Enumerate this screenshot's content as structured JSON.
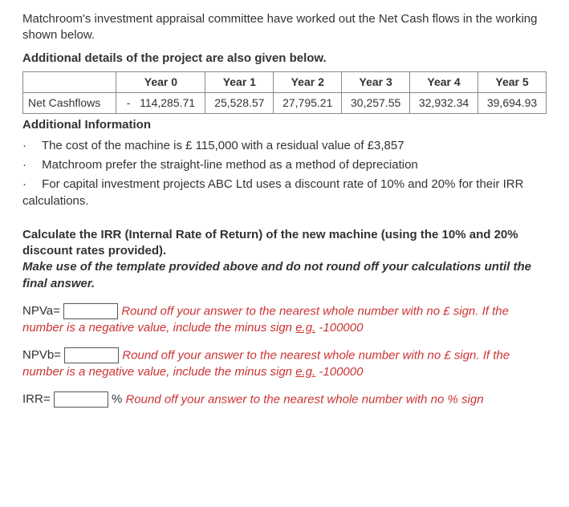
{
  "intro": "Matchroom's investment appraisal committee have worked out the Net Cash flows in the working shown below.",
  "section_title": "Additional details of the project are also given below.",
  "table": {
    "headers": [
      "",
      "Year 0",
      "Year 1",
      "Year 2",
      "Year 3",
      "Year 4",
      "Year 5"
    ],
    "row_label": "Net Cashflows",
    "values": [
      "-   114,285.71",
      "25,528.57",
      "27,795.21",
      "30,257.55",
      "32,932.34",
      "39,694.93"
    ]
  },
  "addl_title": "Additional Information",
  "bullets": [
    "The cost of the machine is £ 115,000 with a residual value of £3,857",
    "Matchroom prefer the straight-line method as a method of depreciation",
    "For capital investment projects ABC Ltd uses a discount rate of 10% and 20% for their IRR calculations."
  ],
  "calc": {
    "instruction": "Calculate the IRR (Internal Rate of Return) of the new machine (using the 10% and 20% discount rates provided).",
    "note": "Make use of the template provided above and do not round off your calculations until the final answer."
  },
  "answers": {
    "npva_label": "NPVa=",
    "npvb_label": "NPVb=",
    "irr_label": "IRR=",
    "irr_suffix": "%",
    "hint_full": "Round off your answer to the nearest whole number with no £ sign. If the number is a negative value, include the minus sign",
    "eg": "e.g.",
    "eg_value": "-100000",
    "hint_irr": "Round off your answer to the nearest whole number with no % sign"
  }
}
